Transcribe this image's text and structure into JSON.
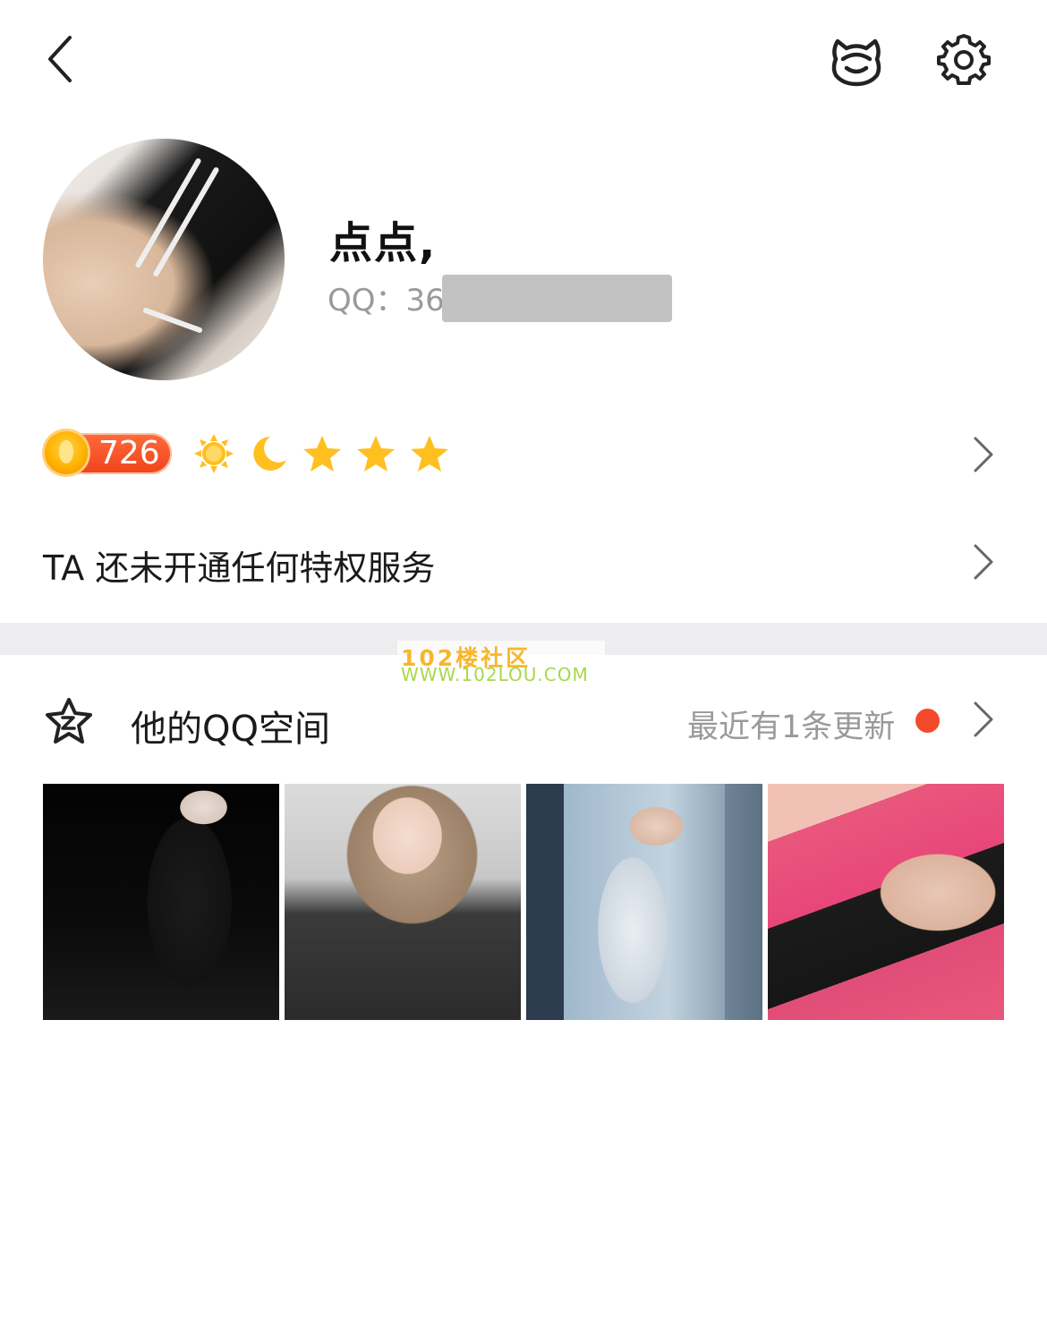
{
  "header": {
    "back_icon": "chevron-left-icon",
    "pet_icon": "pet-icon",
    "settings_icon": "gear-icon"
  },
  "profile": {
    "nickname": "点点,",
    "qq_label": "QQ：36",
    "qq_number_masked": true
  },
  "level": {
    "value": "726",
    "icons": [
      "sun-icon",
      "moon-icon",
      "star-icon",
      "star-icon",
      "star-icon"
    ],
    "colors": {
      "badge": "#f0431b",
      "coin": "#ffb300",
      "icon": "#ffb300"
    }
  },
  "privilege": {
    "text": "TA 还未开通任何特权服务"
  },
  "watermark": {
    "line1": "102楼社区",
    "line2": "WWW.102LOU.COM"
  },
  "qzone": {
    "title": "他的QQ空间",
    "update_text": "最近有1条更新",
    "dot_color": "#f34a2c",
    "photos": [
      {
        "name": "qzone-photo-1"
      },
      {
        "name": "qzone-photo-2"
      },
      {
        "name": "qzone-photo-3"
      },
      {
        "name": "qzone-photo-4"
      }
    ]
  }
}
